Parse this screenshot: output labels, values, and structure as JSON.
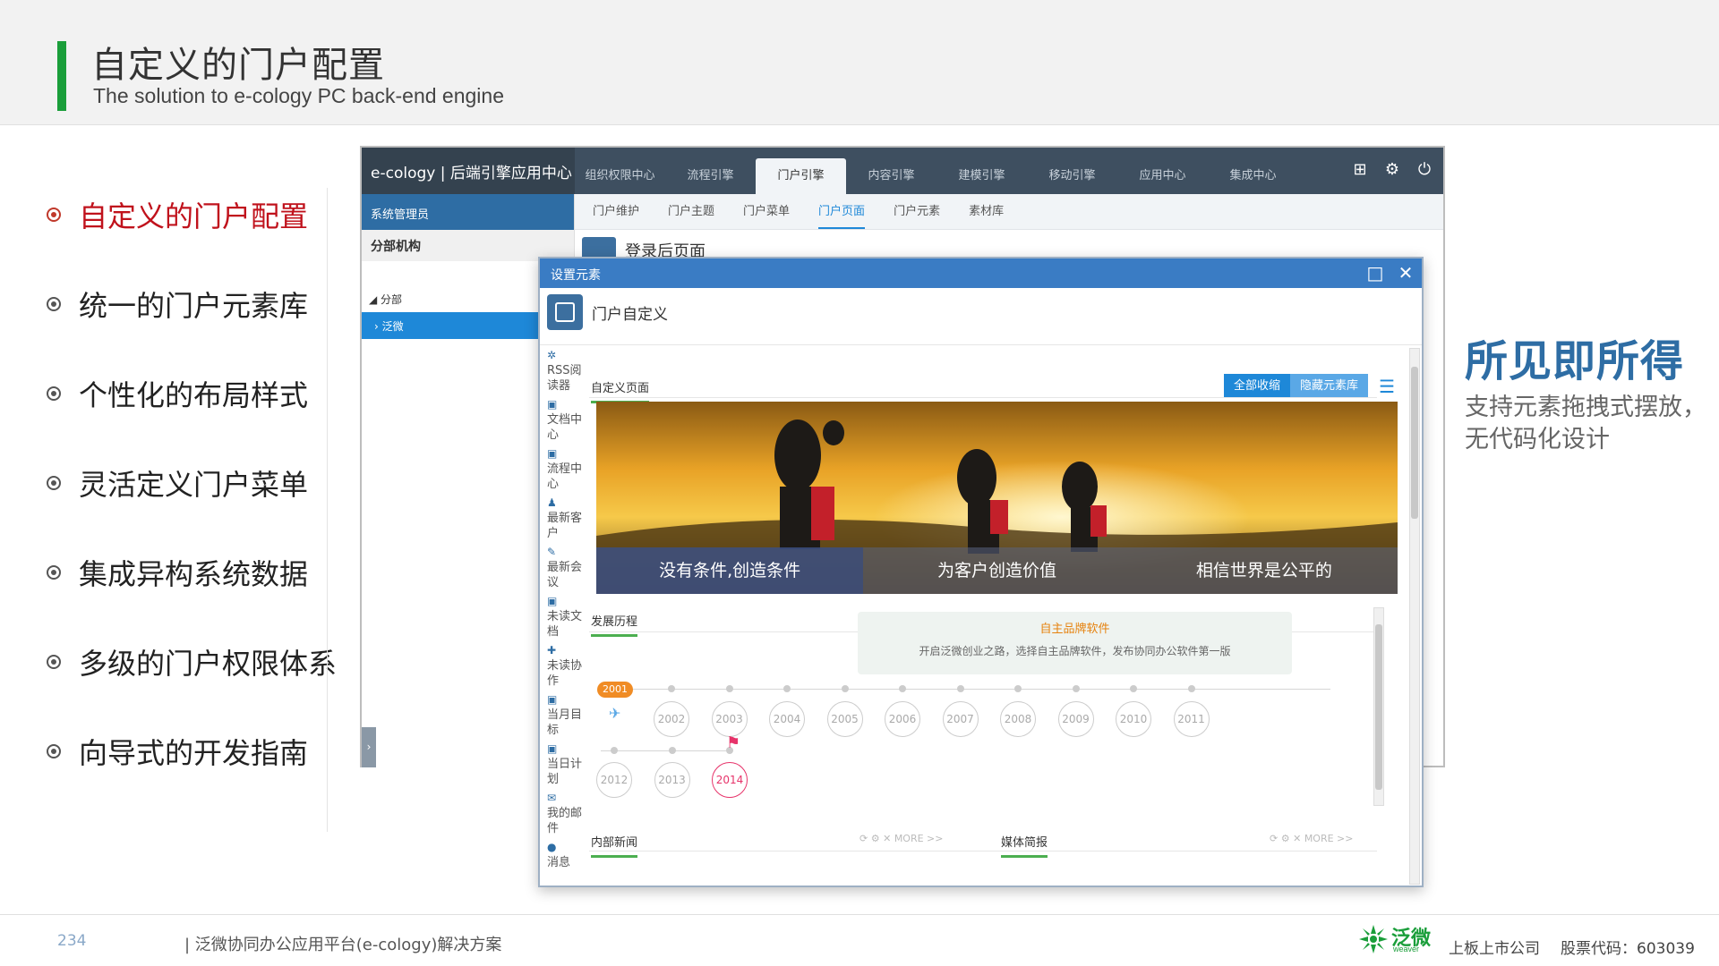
{
  "header": {
    "title": "自定义的门户配置",
    "subtitle": "The solution to e-cology PC back-end engine"
  },
  "features": [
    {
      "label": "自定义的门户配置",
      "active": true
    },
    {
      "label": "统一的门户元素库",
      "active": false
    },
    {
      "label": "个性化的布局样式",
      "active": false
    },
    {
      "label": "灵活定义门户菜单",
      "active": false
    },
    {
      "label": "集成异构系统数据",
      "active": false
    },
    {
      "label": "多级的门户权限体系",
      "active": false
    },
    {
      "label": "向导式的开发指南",
      "active": false
    }
  ],
  "app": {
    "brand": "e-cology | 后端引擎应用中心",
    "nav": [
      "组织权限中心",
      "流程引擎",
      "门户引擎",
      "内容引擎",
      "建模引擎",
      "移动引擎",
      "应用中心",
      "集成中心"
    ],
    "nav_active": "门户引擎",
    "subnav": [
      "门户维护",
      "门户主题",
      "门户菜单",
      "门户页面",
      "门户元素",
      "素材库"
    ],
    "subnav_active": "门户页面",
    "sidebar_user": "系统管理员",
    "sidebar_org": "分部机构",
    "tree_root": "分部",
    "tree_selected": "泛微",
    "page_title": "登录后页面"
  },
  "dialog": {
    "title": "设置元素",
    "header_title": "门户自定义",
    "elements": [
      {
        "icon": "✲",
        "label": "RSS阅读器"
      },
      {
        "icon": "▣",
        "label": "文档中心"
      },
      {
        "icon": "▣",
        "label": "流程中心"
      },
      {
        "icon": "♟",
        "label": "最新客户"
      },
      {
        "icon": "✎",
        "label": "最新会议"
      },
      {
        "icon": "▣",
        "label": "未读文档"
      },
      {
        "icon": "✚",
        "label": "未读协作"
      },
      {
        "icon": "▣",
        "label": "当月目标"
      },
      {
        "icon": "▣",
        "label": "当日计划"
      },
      {
        "icon": "✉",
        "label": "我的邮件"
      },
      {
        "icon": "●",
        "label": "消息"
      }
    ],
    "tab_custom_page": "自定义页面",
    "btn_collapse_all": "全部收缩",
    "btn_hide_library": "隐藏元素库",
    "banner_captions": [
      "没有条件,创造条件",
      "为客户创造价值",
      "相信世界是公平的"
    ],
    "history_tab": "发展历程",
    "milestone_title": "自主品牌软件",
    "milestone_desc": "开启泛微创业之路，选择自主品牌软件，发布协同办公软件第一版",
    "timeline_start": "2001",
    "timeline_row1": [
      "2002",
      "2003",
      "2004",
      "2005",
      "2006",
      "2007",
      "2008",
      "2009",
      "2010",
      "2011"
    ],
    "timeline_row2": [
      "2012",
      "2013",
      "2014"
    ],
    "timeline_highlight": "2014",
    "bottom_tab_left": "内部新闻",
    "bottom_tab_right": "媒体简报",
    "card_more": "MORE >>"
  },
  "right": {
    "tagline": "所见即所得",
    "desc": "支持元素拖拽式摆放，无代码化设计"
  },
  "footer": {
    "page_number": "234",
    "title": "| 泛微协同办公应用平台(e-cology)解决方案",
    "logo_text": "泛微",
    "logo_sub": "weaver",
    "company_type": "上板上市公司",
    "stock_code": "股票代码：603039"
  },
  "colors": {
    "brand_green": "#1a9e3a",
    "accent_red": "#c0121c",
    "accent_blue": "#2e6da4",
    "highlight_pink": "#e7336a"
  }
}
